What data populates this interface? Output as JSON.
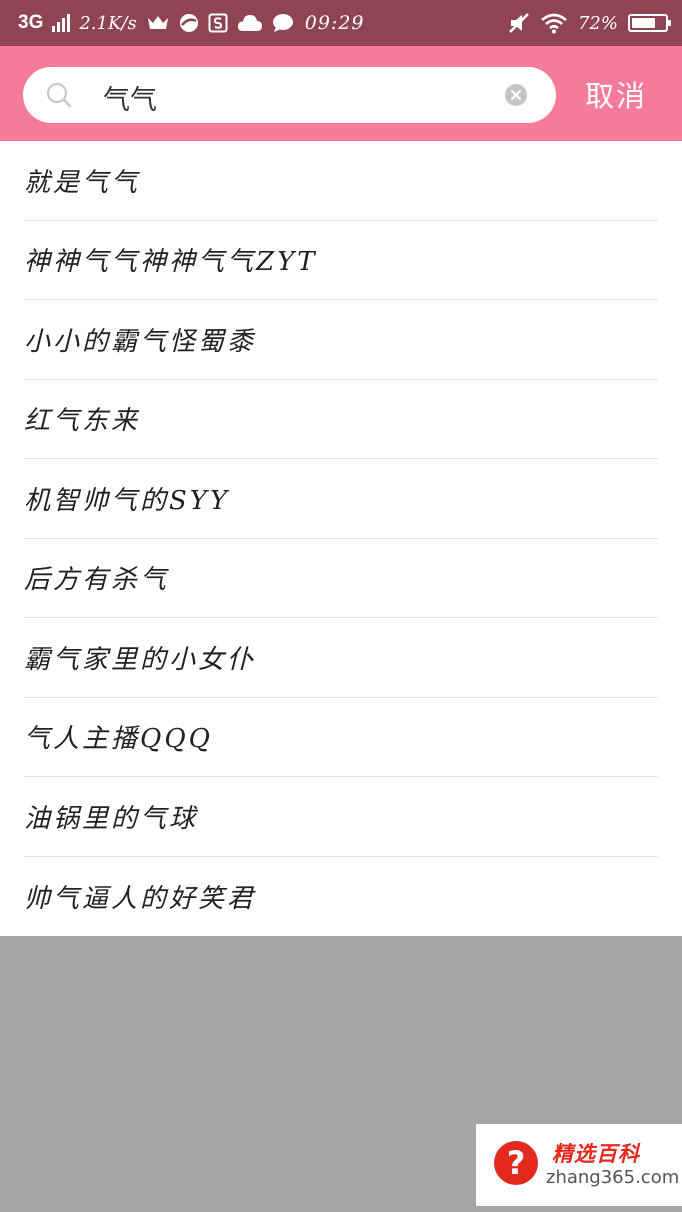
{
  "status_bar": {
    "network": "3G",
    "speed": "2.1K/s",
    "time": "09:29",
    "battery": "72%",
    "battery_level": 0.72
  },
  "search": {
    "query": "气气",
    "cancel_label": "取消"
  },
  "suggestions": [
    {
      "label": "就是气气"
    },
    {
      "label": "神神气气神神气气ZYT"
    },
    {
      "label": "小小的霸气怪蜀黍"
    },
    {
      "label": "红气东来"
    },
    {
      "label": "机智帅气的SYY"
    },
    {
      "label": "后方有杀气"
    },
    {
      "label": "霸气家里的小女仆"
    },
    {
      "label": "气人主播QQQ"
    },
    {
      "label": "油锅里的气球"
    },
    {
      "label": "帅气逼人的好笑君"
    }
  ],
  "watermark": {
    "badge": "?",
    "title": "精选百科",
    "url": "zhang365.com"
  },
  "colors": {
    "status_bar": "#8f4454",
    "header": "#f57a9b",
    "overlay": "#a6a6a6",
    "watermark_red": "#e42a1f"
  },
  "icons": {
    "status_left": [
      "crown-icon",
      "browser-icon",
      "s-app-icon",
      "cloud-icon",
      "chat-bubble-icon"
    ],
    "status_right": [
      "mute-icon",
      "wifi-icon",
      "battery-icon"
    ],
    "search": "search-icon",
    "clear": "clear-icon"
  }
}
